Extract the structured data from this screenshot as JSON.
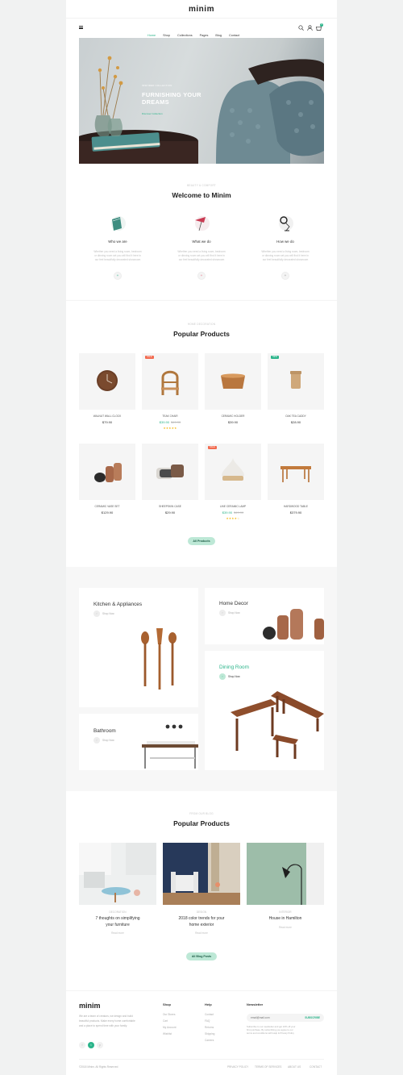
{
  "header": {
    "brand": "minim",
    "menu_icon": "hamburger-icon",
    "nav": [
      "Home",
      "Shop",
      "Collections",
      "Pages",
      "Blog",
      "Contact"
    ],
    "active_nav": "Home",
    "search_icon": "search-icon",
    "account_icon": "user-icon",
    "cart_icon": "cart-icon",
    "cart_count": "0"
  },
  "hero": {
    "kicker": "INSPIRED COLLECTION",
    "title_line1": "FURNISHING YOUR",
    "title_line2": "DREAMS",
    "cta": "Discover Collection"
  },
  "welcome": {
    "kicker": "BEAUTY & COMFORT",
    "title": "Welcome to Minim",
    "items": [
      {
        "title": "Who we are",
        "text_line1": "Whether you need a living room, bedroom",
        "text_line2": "or dinning room set you will find it here in",
        "text_line3": "our feel beautifully decorated showroom",
        "icon": "book-icon"
      },
      {
        "title": "What we do",
        "text_line1": "Whether you need a living room, bedroom",
        "text_line2": "or dinning room set you will find it here in",
        "text_line3": "our feel beautifully decorated showroom",
        "icon": "lamp-icon"
      },
      {
        "title": "How we do",
        "text_line1": "Whether you need a living room, bedroom",
        "text_line2": "or dinning room set you will find it here in",
        "text_line3": "our feel beautifully decorated showroom",
        "icon": "desk-lamp-icon"
      }
    ],
    "more": "+"
  },
  "products": {
    "kicker": "HOME DECORATION",
    "title": "Popular Products",
    "cta": "All Products",
    "items": [
      {
        "name": "WALNUT WALL CLOCK",
        "price": "$79.90",
        "old": "",
        "badge": "",
        "stars": ""
      },
      {
        "name": "TEAK CHAIR",
        "price": "$39.90",
        "old": "$49.90",
        "badge": "SALE",
        "stars": "★★★★★"
      },
      {
        "name": "CERAMIC HOLDER",
        "price": "$39.90",
        "old": "",
        "badge": "",
        "stars": ""
      },
      {
        "name": "OAK TEA CADDY",
        "price": "$28.90",
        "old": "",
        "badge": "NEW",
        "stars": ""
      },
      {
        "name": "CERAMIC VASE SET",
        "price": "$129.90",
        "old": "",
        "badge": "",
        "stars": ""
      },
      {
        "name": "SHEEPSKIN CASE",
        "price": "$29.90",
        "old": "",
        "badge": "",
        "stars": ""
      },
      {
        "name": "LINE CERAMIC LAMP",
        "price": "$39.90",
        "old": "$49.90",
        "badge": "SALE",
        "stars": "★★★★☆"
      },
      {
        "name": "HARDWOOD TABLE",
        "price": "$379.90",
        "old": "",
        "badge": "",
        "stars": ""
      }
    ]
  },
  "categories": {
    "shop_now": "Shop Now",
    "kitchen": "Kitchen & Appliances",
    "home_decor": "Home Decor",
    "dining": "Dining Room",
    "bathroom": "Bathroom"
  },
  "blog": {
    "kicker": "FROM OUR BLOG",
    "title": "Popular Products",
    "cta": "All Blog Posts",
    "posts": [
      {
        "category": "DECORATION",
        "title_line1": "7 thoughts on simplifying",
        "title_line2": "your furniture",
        "link": "Read more"
      },
      {
        "category": "DESIGN",
        "title_line1": "2018 color trends for your",
        "title_line2": "home  exterior",
        "link": "Read more"
      },
      {
        "category": "INTERIOR",
        "title_line1": "House in Hamilton",
        "title_line2": "",
        "link": "Read more"
      }
    ]
  },
  "footer": {
    "brand": "minim",
    "about_line1": "We are a team of creators, we design and build",
    "about_line2": "beautiful products. Make every home comfortable",
    "about_line3": "and a place to spend time with your family.",
    "social": [
      "f",
      "t",
      "p"
    ],
    "shop_title": "Shop",
    "shop_links": [
      "Our Stores",
      "Cart",
      "My Account",
      "Wishlist"
    ],
    "help_title": "Help",
    "help_links": [
      "Contact",
      "FAQ",
      "Returns",
      "Shipping",
      "Careers"
    ],
    "newsletter_title": "Newsletter",
    "newsletter_placeholder": "email@mail.com",
    "subscribe": "SUBSCRIBE",
    "newsletter_note_line1": "Subscribe to our newsletter and get 10% off your",
    "newsletter_note_line2": "first purchase. By subscribing you agree to our",
    "newsletter_note_line3": "terms and conditions with Help & Privacy Policy",
    "copyright": "©2018 Minim. All Rights Reserved",
    "bottom_links": [
      "PRIVACY POLICY",
      "TERMS OF SERVICES",
      "ABOUT US",
      "CONTACT"
    ]
  },
  "colors": {
    "accent": "#2bb48a",
    "sale": "#f26a4f",
    "new": "#2bb48a",
    "pill": "#bde8d6"
  }
}
